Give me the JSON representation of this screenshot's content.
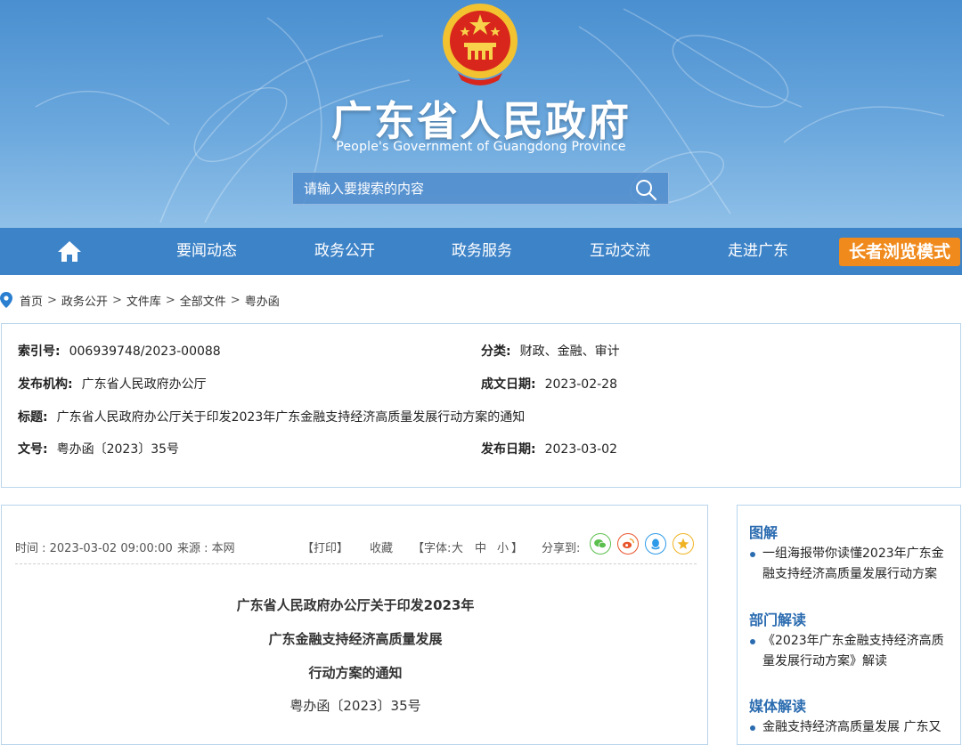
{
  "header": {
    "title": "广东省人民政府",
    "subtitle": "People's Government of Guangdong Province",
    "search_placeholder": "请输入要搜索的内容"
  },
  "nav": {
    "items": [
      "要闻动态",
      "政务公开",
      "政务服务",
      "互动交流",
      "走进广东"
    ],
    "elder_mode": "长者浏览模式"
  },
  "breadcrumb": [
    "首页",
    "政务公开",
    "文件库",
    "全部文件",
    "粤办函"
  ],
  "meta": {
    "index_label": "索引号:",
    "index_value": "006939748/2023-00088",
    "category_label": "分类:",
    "category_value": "财政、金融、审计",
    "issuer_label": "发布机构:",
    "issuer_value": "广东省人民政府办公厅",
    "written_label": "成文日期:",
    "written_value": "2023-02-28",
    "title_label": "标题:",
    "title_value": "广东省人民政府办公厅关于印发2023年广东金融支持经济高质量发展行动方案的通知",
    "docno_label": "文号:",
    "docno_value": "粤办函〔2023〕35号",
    "published_label": "发布日期:",
    "published_value": "2023-03-02"
  },
  "article": {
    "time": "时间 : 2023-03-02 09:00:00",
    "source": "来源 : 本网",
    "print": "【打印】",
    "favorite": "收藏",
    "font_prefix": "【字体:",
    "font_large": "大",
    "font_medium": "中",
    "font_small": "小",
    "font_suffix": "】",
    "share_label": "分享到:",
    "title_lines": [
      "广东省人民政府办公厅关于印发2023年",
      "广东金融支持经济高质量发展",
      "行动方案的通知"
    ],
    "doc_number": "粤办函〔2023〕35号"
  },
  "sidebar": {
    "sections": [
      {
        "heading": "图解",
        "item": "一组海报带你读懂2023年广东金融支持经济高质量发展行动方案"
      },
      {
        "heading": "部门解读",
        "item": "《2023年广东金融支持经济高质量发展行动方案》解读"
      },
      {
        "heading": "媒体解读",
        "item": "金融支持经济高质量发展 广东又"
      }
    ]
  },
  "colors": {
    "nav_bg": "#3d83c8",
    "elder_btn": "#f08a1c",
    "link_blue": "#2b6cb0",
    "border": "#b9d5ec"
  }
}
